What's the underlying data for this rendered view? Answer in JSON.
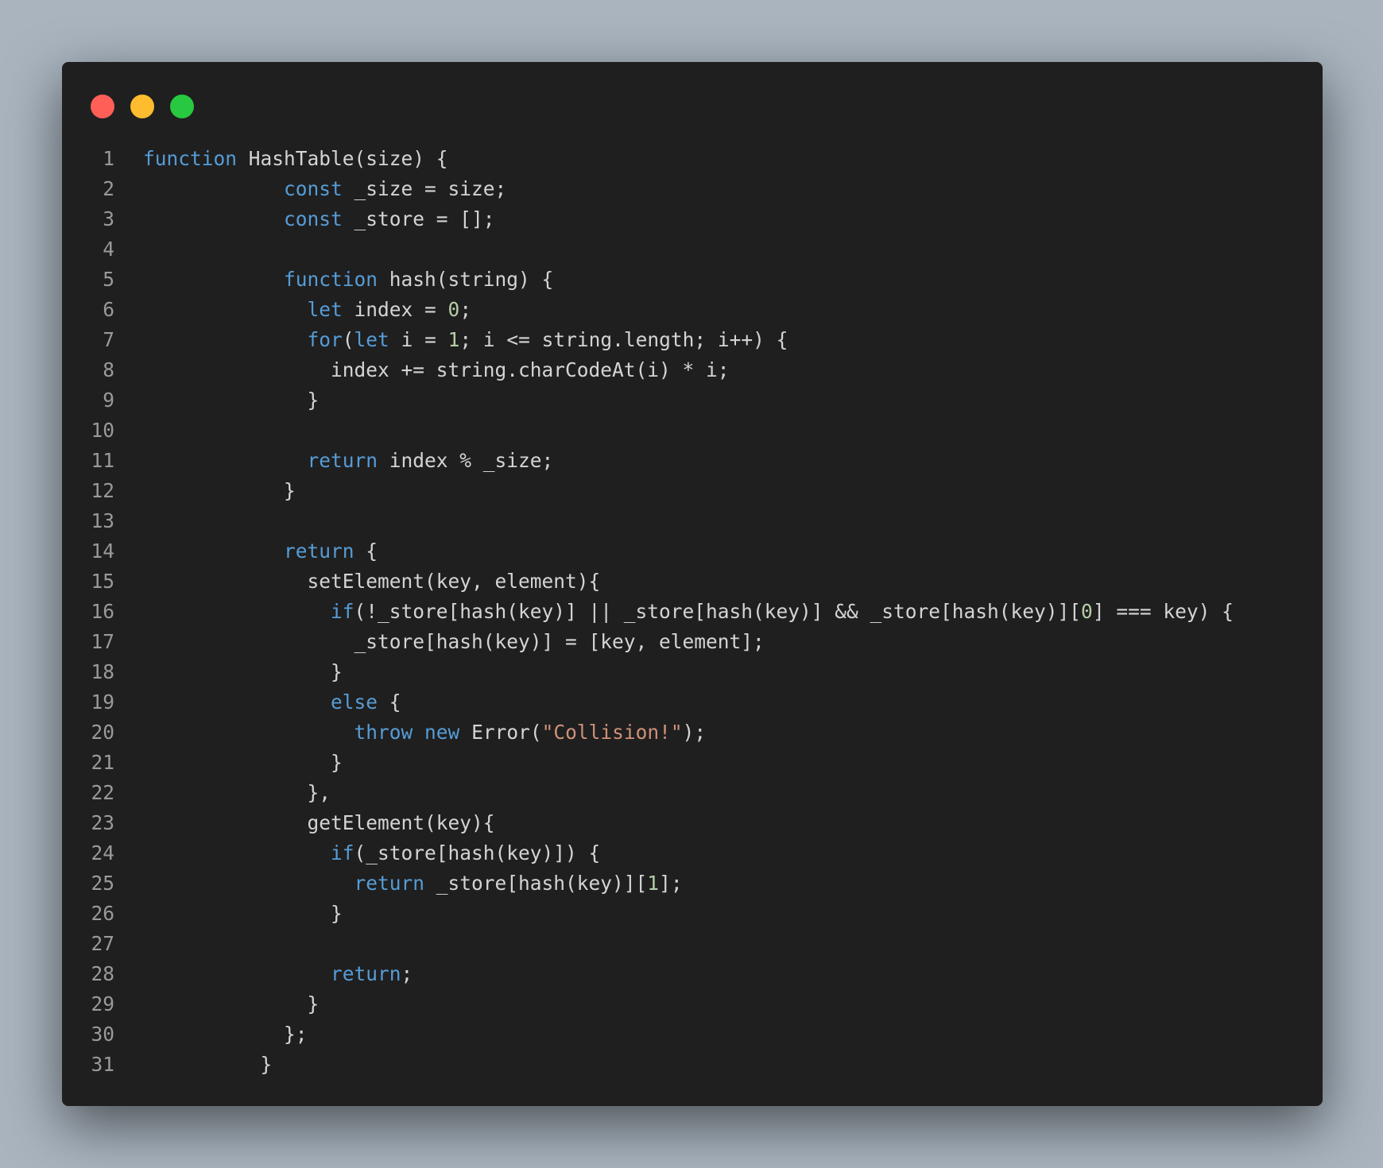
{
  "window": {
    "controls": [
      {
        "name": "close",
        "color": "#ff5f57"
      },
      {
        "name": "minimize",
        "color": "#febc2e"
      },
      {
        "name": "maximize",
        "color": "#28c840"
      }
    ]
  },
  "theme": {
    "background": "#1f1f1f",
    "page_background": "#a9b4bf",
    "text": "#d4d4d4",
    "keyword": "#569cd6",
    "number": "#b5cea8",
    "string": "#ce9178",
    "line_number": "#9a9a9a"
  },
  "code": {
    "lines": [
      {
        "n": "1",
        "tokens": [
          {
            "t": "kw",
            "v": "function"
          },
          {
            "t": "plain",
            "v": " HashTable(size) {"
          }
        ]
      },
      {
        "n": "2",
        "tokens": [
          {
            "t": "plain",
            "v": "            "
          },
          {
            "t": "kw",
            "v": "const"
          },
          {
            "t": "plain",
            "v": " _size = size;"
          }
        ]
      },
      {
        "n": "3",
        "tokens": [
          {
            "t": "plain",
            "v": "            "
          },
          {
            "t": "kw",
            "v": "const"
          },
          {
            "t": "plain",
            "v": " _store = [];"
          }
        ]
      },
      {
        "n": "4",
        "tokens": []
      },
      {
        "n": "5",
        "tokens": [
          {
            "t": "plain",
            "v": "            "
          },
          {
            "t": "kw",
            "v": "function"
          },
          {
            "t": "plain",
            "v": " hash(string) {"
          }
        ]
      },
      {
        "n": "6",
        "tokens": [
          {
            "t": "plain",
            "v": "              "
          },
          {
            "t": "kw",
            "v": "let"
          },
          {
            "t": "plain",
            "v": " index = "
          },
          {
            "t": "num",
            "v": "0"
          },
          {
            "t": "plain",
            "v": ";"
          }
        ]
      },
      {
        "n": "7",
        "tokens": [
          {
            "t": "plain",
            "v": "              "
          },
          {
            "t": "kw",
            "v": "for"
          },
          {
            "t": "plain",
            "v": "("
          },
          {
            "t": "kw",
            "v": "let"
          },
          {
            "t": "plain",
            "v": " i = "
          },
          {
            "t": "num",
            "v": "1"
          },
          {
            "t": "plain",
            "v": "; i <= string.length; i++) {"
          }
        ]
      },
      {
        "n": "8",
        "tokens": [
          {
            "t": "plain",
            "v": "                index += string.charCodeAt(i) * i;"
          }
        ]
      },
      {
        "n": "9",
        "tokens": [
          {
            "t": "plain",
            "v": "              }"
          }
        ]
      },
      {
        "n": "10",
        "tokens": []
      },
      {
        "n": "11",
        "tokens": [
          {
            "t": "plain",
            "v": "              "
          },
          {
            "t": "kw",
            "v": "return"
          },
          {
            "t": "plain",
            "v": " index % _size;"
          }
        ]
      },
      {
        "n": "12",
        "tokens": [
          {
            "t": "plain",
            "v": "            }"
          }
        ]
      },
      {
        "n": "13",
        "tokens": []
      },
      {
        "n": "14",
        "tokens": [
          {
            "t": "plain",
            "v": "            "
          },
          {
            "t": "kw",
            "v": "return"
          },
          {
            "t": "plain",
            "v": " {"
          }
        ]
      },
      {
        "n": "15",
        "tokens": [
          {
            "t": "plain",
            "v": "              setElement(key, element){"
          }
        ]
      },
      {
        "n": "16",
        "tokens": [
          {
            "t": "plain",
            "v": "                "
          },
          {
            "t": "kw",
            "v": "if"
          },
          {
            "t": "plain",
            "v": "(!_store[hash(key)] || _store[hash(key)] && _store[hash(key)]["
          },
          {
            "t": "num",
            "v": "0"
          },
          {
            "t": "plain",
            "v": "] === key) {"
          }
        ]
      },
      {
        "n": "17",
        "tokens": [
          {
            "t": "plain",
            "v": "                  _store[hash(key)] = [key, element];"
          }
        ]
      },
      {
        "n": "18",
        "tokens": [
          {
            "t": "plain",
            "v": "                }"
          }
        ]
      },
      {
        "n": "19",
        "tokens": [
          {
            "t": "plain",
            "v": "                "
          },
          {
            "t": "kw",
            "v": "else"
          },
          {
            "t": "plain",
            "v": " {"
          }
        ]
      },
      {
        "n": "20",
        "tokens": [
          {
            "t": "plain",
            "v": "                  "
          },
          {
            "t": "kw",
            "v": "throw"
          },
          {
            "t": "plain",
            "v": " "
          },
          {
            "t": "kw",
            "v": "new"
          },
          {
            "t": "plain",
            "v": " Error("
          },
          {
            "t": "str",
            "v": "\"Collision!\""
          },
          {
            "t": "plain",
            "v": ");"
          }
        ]
      },
      {
        "n": "21",
        "tokens": [
          {
            "t": "plain",
            "v": "                }"
          }
        ]
      },
      {
        "n": "22",
        "tokens": [
          {
            "t": "plain",
            "v": "              },"
          }
        ]
      },
      {
        "n": "23",
        "tokens": [
          {
            "t": "plain",
            "v": "              getElement(key){"
          }
        ]
      },
      {
        "n": "24",
        "tokens": [
          {
            "t": "plain",
            "v": "                "
          },
          {
            "t": "kw",
            "v": "if"
          },
          {
            "t": "plain",
            "v": "(_store[hash(key)]) {"
          }
        ]
      },
      {
        "n": "25",
        "tokens": [
          {
            "t": "plain",
            "v": "                  "
          },
          {
            "t": "kw",
            "v": "return"
          },
          {
            "t": "plain",
            "v": " _store[hash(key)]["
          },
          {
            "t": "num",
            "v": "1"
          },
          {
            "t": "plain",
            "v": "];"
          }
        ]
      },
      {
        "n": "26",
        "tokens": [
          {
            "t": "plain",
            "v": "                }"
          }
        ]
      },
      {
        "n": "27",
        "tokens": []
      },
      {
        "n": "28",
        "tokens": [
          {
            "t": "plain",
            "v": "                "
          },
          {
            "t": "kw",
            "v": "return"
          },
          {
            "t": "plain",
            "v": ";"
          }
        ]
      },
      {
        "n": "29",
        "tokens": [
          {
            "t": "plain",
            "v": "              }"
          }
        ]
      },
      {
        "n": "30",
        "tokens": [
          {
            "t": "plain",
            "v": "            };"
          }
        ]
      },
      {
        "n": "31",
        "tokens": [
          {
            "t": "plain",
            "v": "          }"
          }
        ]
      }
    ]
  }
}
